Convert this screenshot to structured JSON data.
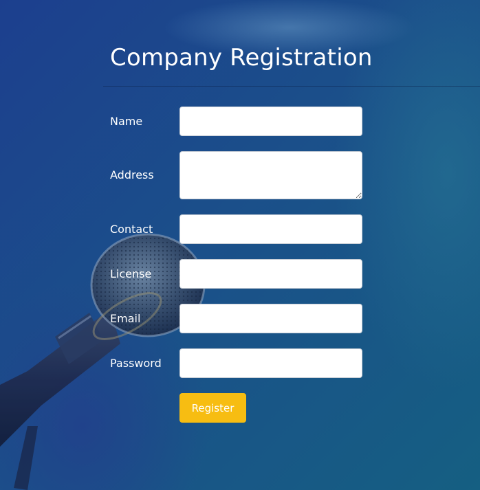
{
  "form": {
    "title": "Company Registration",
    "fields": [
      {
        "label": "Name",
        "value": "",
        "placeholder": ""
      },
      {
        "label": "Address",
        "value": "",
        "placeholder": ""
      },
      {
        "label": "Contact",
        "value": "",
        "placeholder": ""
      },
      {
        "label": "License",
        "value": "",
        "placeholder": ""
      },
      {
        "label": "Email",
        "value": "",
        "placeholder": ""
      },
      {
        "label": "Password",
        "value": "",
        "placeholder": ""
      }
    ],
    "submit_label": "Register"
  },
  "colors": {
    "background": "#1c4a8a",
    "button": "#f7bd12",
    "text": "#ffffff"
  }
}
